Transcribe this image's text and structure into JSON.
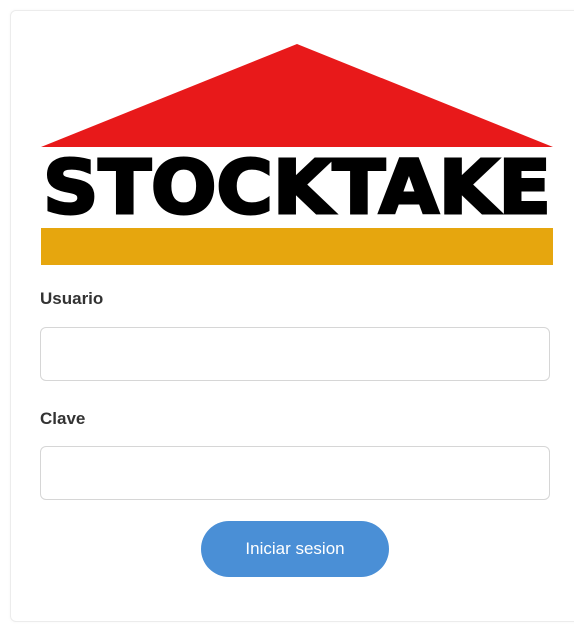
{
  "logo": {
    "text": "STOCKTAKE",
    "roof_color": "#e8191a",
    "bar_color": "#e6a60e",
    "text_color": "#000000"
  },
  "form": {
    "username_label": "Usuario",
    "username_value": "",
    "password_label": "Clave",
    "password_value": "",
    "submit_label": "Iniciar sesion"
  },
  "colors": {
    "button": "#4a8fd6"
  }
}
